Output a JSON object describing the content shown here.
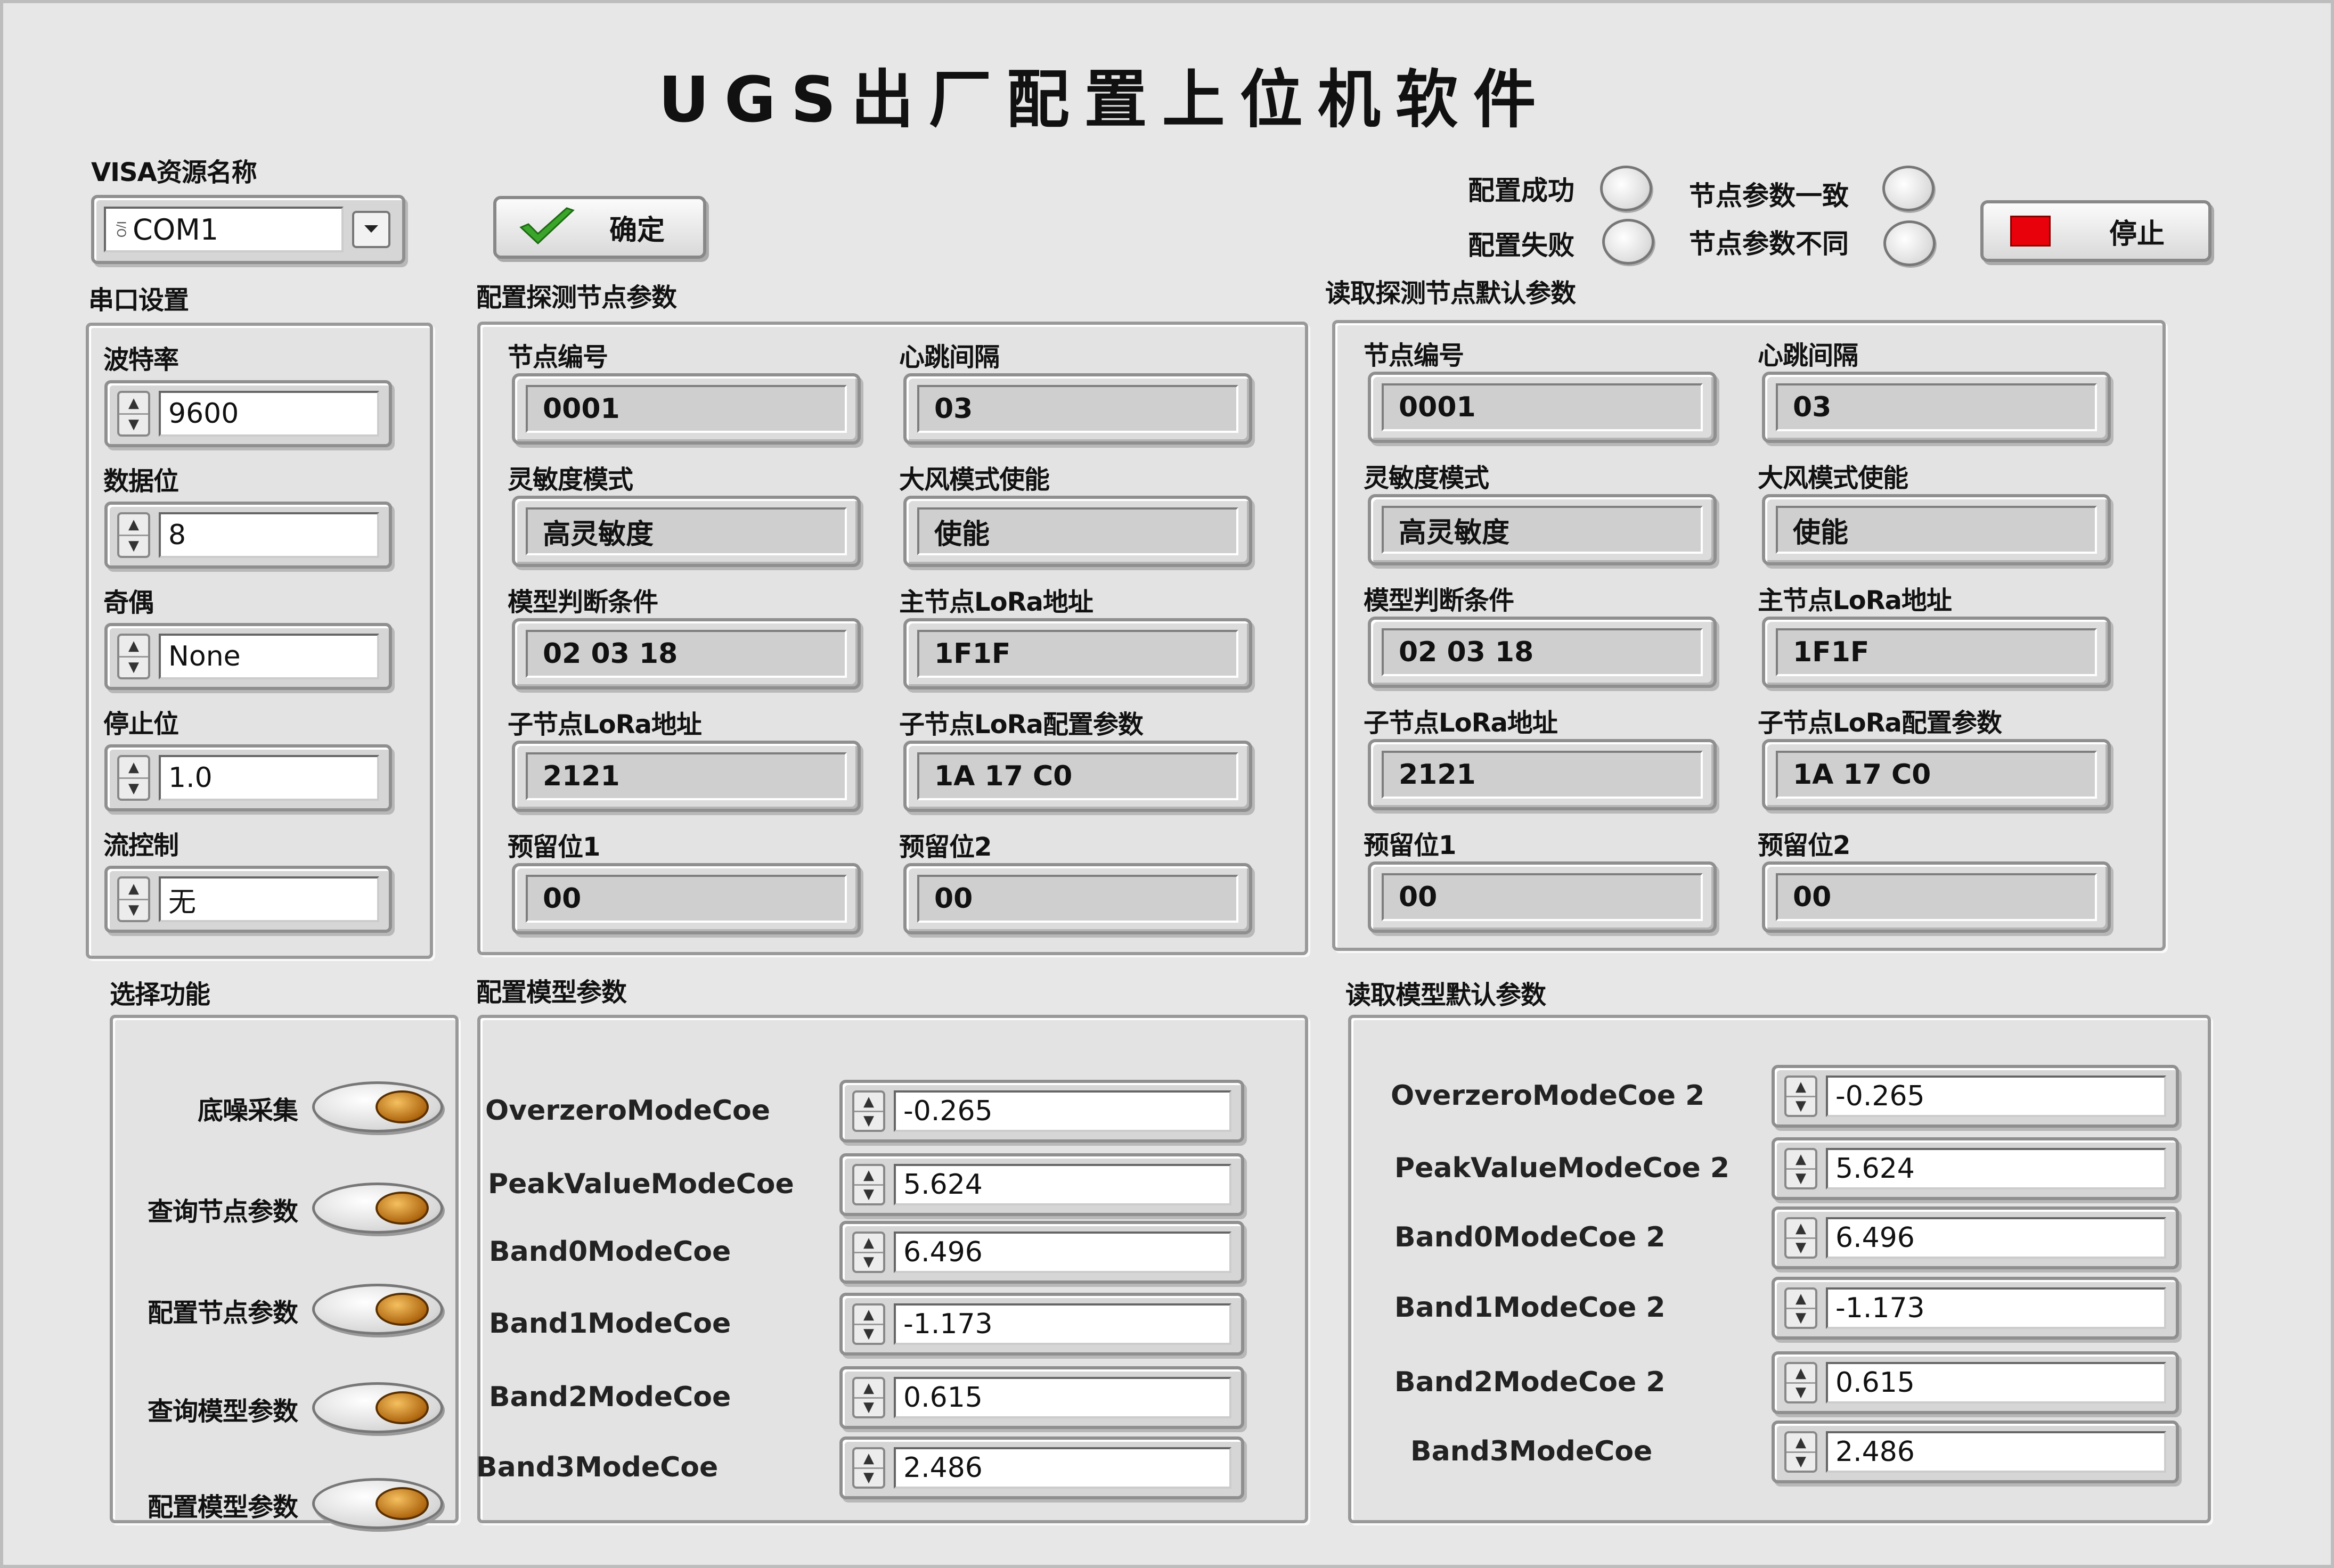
{
  "app": {
    "title": "UGS出厂配置上位机软件"
  },
  "visa": {
    "label": "VISA资源名称",
    "io_glyph": "I/O",
    "value": "COM1"
  },
  "ok_button": {
    "label": "确定"
  },
  "stop_button": {
    "label": "停止"
  },
  "indicators": {
    "config_success": "配置成功",
    "config_fail": "配置失败",
    "node_params_same": "节点参数一致",
    "node_params_diff": "节点参数不同"
  },
  "serial": {
    "section": "串口设置",
    "fields": [
      {
        "label": "波特率",
        "value": "9600"
      },
      {
        "label": "数据位",
        "value": "8"
      },
      {
        "label": "奇偶",
        "value": "None"
      },
      {
        "label": "停止位",
        "value": "1.0"
      },
      {
        "label": "流控制",
        "value": "无"
      }
    ]
  },
  "config_node": {
    "section": "配置探测节点参数",
    "fields": [
      {
        "label": "节点编号",
        "value": "0001"
      },
      {
        "label": "心跳间隔",
        "value": "03"
      },
      {
        "label": "灵敏度模式",
        "value": "高灵敏度"
      },
      {
        "label": "大风模式使能",
        "value": "使能"
      },
      {
        "label": "模型判断条件",
        "value": "02 03 18"
      },
      {
        "label": "主节点LoRa地址",
        "value": "1F1F"
      },
      {
        "label": "子节点LoRa地址",
        "value": "2121"
      },
      {
        "label": "子节点LoRa配置参数",
        "value": "1A 17 C0"
      },
      {
        "label": "预留位1",
        "value": "00"
      },
      {
        "label": "预留位2",
        "value": "00"
      }
    ]
  },
  "read_node": {
    "section": "读取探测节点默认参数",
    "fields": [
      {
        "label": "节点编号",
        "value": "0001"
      },
      {
        "label": "心跳间隔",
        "value": "03"
      },
      {
        "label": "灵敏度模式",
        "value": "高灵敏度"
      },
      {
        "label": "大风模式使能",
        "value": "使能"
      },
      {
        "label": "模型判断条件",
        "value": "02 03 18"
      },
      {
        "label": "主节点LoRa地址",
        "value": "1F1F"
      },
      {
        "label": "子节点LoRa地址",
        "value": "2121"
      },
      {
        "label": "子节点LoRa配置参数",
        "value": "1A 17 C0"
      },
      {
        "label": "预留位1",
        "value": "00"
      },
      {
        "label": "预留位2",
        "value": "00"
      }
    ]
  },
  "functions": {
    "section": "选择功能",
    "items": [
      "底噪采集",
      "查询节点参数",
      "配置节点参数",
      "查询模型参数",
      "配置模型参数"
    ]
  },
  "config_model": {
    "section": "配置模型参数",
    "rows": [
      {
        "label": "OverzeroModeCoe",
        "value": "-0.265"
      },
      {
        "label": "PeakValueModeCoe",
        "value": "5.624"
      },
      {
        "label": "Band0ModeCoe",
        "value": "6.496"
      },
      {
        "label": "Band1ModeCoe",
        "value": "-1.173"
      },
      {
        "label": "Band2ModeCoe",
        "value": "0.615"
      },
      {
        "label": "Band3ModeCoe",
        "value": "2.486"
      }
    ]
  },
  "read_model": {
    "section": "读取模型默认参数",
    "rows": [
      {
        "label": "OverzeroModeCoe 2",
        "value": "-0.265"
      },
      {
        "label": "PeakValueModeCoe  2",
        "value": "5.624"
      },
      {
        "label": "Band0ModeCoe 2",
        "value": "6.496"
      },
      {
        "label": "Band1ModeCoe 2",
        "value": "-1.173"
      },
      {
        "label": "Band2ModeCoe 2",
        "value": "0.615"
      },
      {
        "label": "Band3ModeCoe",
        "value": "2.486"
      }
    ]
  },
  "colors": {
    "stop_indicator": "#e8000b",
    "check_green": "#3aa52a",
    "toggle_knob": "#b06810"
  }
}
